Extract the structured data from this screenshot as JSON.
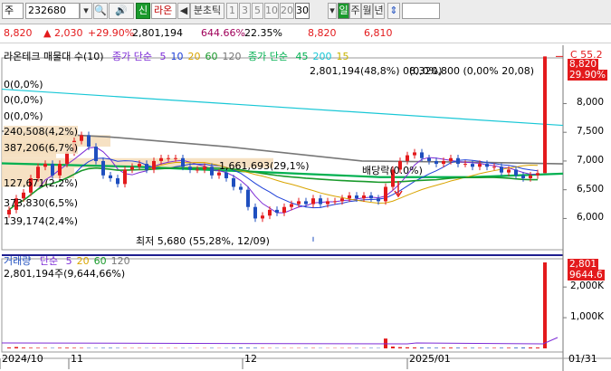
{
  "toolbar": {
    "market_select": "주",
    "stock_code": "232680",
    "stock_name": "라온",
    "new_badge": "신",
    "period_label": "분초틱",
    "intervals": [
      "1",
      "3",
      "5",
      "10",
      "20",
      "30"
    ],
    "interval_selected": "30",
    "period_buttons": [
      "일",
      "주",
      "월",
      "년"
    ],
    "period_selected": "일"
  },
  "price_row": {
    "price": "8,820",
    "change": "2,030",
    "change_pct": "+29.90%",
    "volume": "2,801,194",
    "volume_pct": "644.66%",
    "turnover": "22.35%",
    "high": "8,820",
    "low": "6,810"
  },
  "legend": {
    "title": "라온테크 매물대 수(10)",
    "ma_label": "종가 단순",
    "ma_periods": [
      "5",
      "10",
      "20",
      "60",
      "120"
    ],
    "ma2_label": "종가 단순",
    "ma2_periods": [
      "45",
      "200",
      "15"
    ],
    "top_right": "C 55.2"
  },
  "colors": {
    "up": "#e31a1c",
    "down": "#1f4fbf",
    "ma5": "#7d2bd6",
    "ma10": "#1e40d8",
    "ma20": "#d9a400",
    "ma60": "#1a9a2c",
    "ma120": "#777777",
    "ma45": "#00b050",
    "ma200": "#18c7d6",
    "ma15": "#c8b400",
    "tan": "#f4dcb8"
  },
  "annotations": {
    "vol_profile_top": "2,801,194(48,8%) 0(0,0%)",
    "top_right_overlap": "8,320,800 (0,00% 20,08)",
    "p1": "0(0,0%)",
    "p2": "0(0,0%)",
    "p3": "0(0,0%)",
    "p4": "240,508(4,2%)",
    "p5": "387,206(6,7%)",
    "p6": "1,661,693(29,1%)",
    "p7": "127,671(2,2%)",
    "p8": "373,830(6,5%)",
    "p9": "139,174(2,4%)",
    "dividend": "배당락(0.0%)",
    "low": "최저 5,680 (55,28%, 12/09)"
  },
  "price_axis": {
    "ticks": [
      "8,000",
      "7,500",
      "7,000",
      "6,500",
      "6,000"
    ],
    "current": "8,820",
    "current_pct": "29.90%"
  },
  "volume_panel": {
    "legend_label": "거래량",
    "ma_label": "단순",
    "ma_periods": [
      "5",
      "20",
      "60",
      "120"
    ],
    "summary": "2,801,194주(9,644,66%)",
    "ticks": [
      "2,000K",
      "1,000K"
    ],
    "current": "2,801",
    "current_pct": "9644.6"
  },
  "x_axis": {
    "labels": [
      "2024/10",
      "11",
      "12",
      "2025/01",
      "01/31"
    ]
  },
  "chart_data": {
    "type": "candlestick",
    "price_ylim": [
      5680,
      8820
    ],
    "volume_ylim": [
      0,
      2801194
    ],
    "dates": [
      "10/10",
      "10/11",
      "10/14",
      "10/15",
      "10/16",
      "10/17",
      "10/18",
      "10/21",
      "10/22",
      "10/23",
      "10/24",
      "10/25",
      "10/28",
      "10/29",
      "10/30",
      "10/31",
      "11/01",
      "11/04",
      "11/05",
      "11/06",
      "11/07",
      "11/08",
      "11/11",
      "11/12",
      "11/13",
      "11/14",
      "11/15",
      "11/18",
      "11/19",
      "11/20",
      "11/21",
      "11/22",
      "11/25",
      "11/26",
      "11/27",
      "11/28",
      "11/29",
      "12/02",
      "12/03",
      "12/04",
      "12/05",
      "12/06",
      "12/09",
      "12/10",
      "12/11",
      "12/12",
      "12/13",
      "12/16",
      "12/17",
      "12/18",
      "12/19",
      "12/20",
      "12/23",
      "12/24",
      "12/26",
      "12/27",
      "12/30",
      "01/02",
      "01/03",
      "01/06",
      "01/07",
      "01/08",
      "01/09",
      "01/10",
      "01/13",
      "01/14",
      "01/15",
      "01/16",
      "01/17",
      "01/20",
      "01/21",
      "01/22",
      "01/23",
      "01/24",
      "01/31"
    ],
    "close": [
      6150,
      6350,
      6450,
      6700,
      6900,
      6950,
      6750,
      6950,
      7150,
      7350,
      7450,
      7250,
      7000,
      6750,
      6700,
      6600,
      6850,
      6900,
      6950,
      6850,
      7000,
      7050,
      7050,
      7050,
      6900,
      6850,
      6850,
      6900,
      6750,
      6800,
      6700,
      6550,
      6500,
      6200,
      6000,
      6050,
      6150,
      6100,
      6200,
      6250,
      6300,
      6250,
      6350,
      6250,
      6300,
      6300,
      6350,
      6400,
      6350,
      6400,
      6350,
      6300,
      6550,
      6850,
      7000,
      7100,
      7150,
      7050,
      7000,
      6950,
      7000,
      7050,
      6950,
      6950,
      6900,
      6950,
      6900,
      6900,
      6800,
      6850,
      6750,
      6700,
      6750,
      6790,
      8820
    ],
    "volume": [
      30000,
      45000,
      25000,
      20000,
      18000,
      15000,
      12000,
      20000,
      22000,
      18000,
      15000,
      12000,
      10000,
      14000,
      16000,
      12000,
      10000,
      9000,
      11000,
      8000,
      9000,
      7000,
      8000,
      9000,
      10000,
      8000,
      7000,
      9000,
      12000,
      8000,
      9000,
      15000,
      20000,
      18000,
      16000,
      12000,
      10000,
      9000,
      8000,
      9000,
      10000,
      11000,
      12000,
      9000,
      8000,
      9000,
      10000,
      12000,
      11000,
      9000,
      12000,
      10000,
      320000,
      60000,
      40000,
      35000,
      30000,
      25000,
      20000,
      18000,
      22000,
      25000,
      20000,
      18000,
      16000,
      15000,
      14000,
      16000,
      18000,
      20000,
      22000,
      25000,
      30000,
      28000,
      2801194
    ]
  }
}
